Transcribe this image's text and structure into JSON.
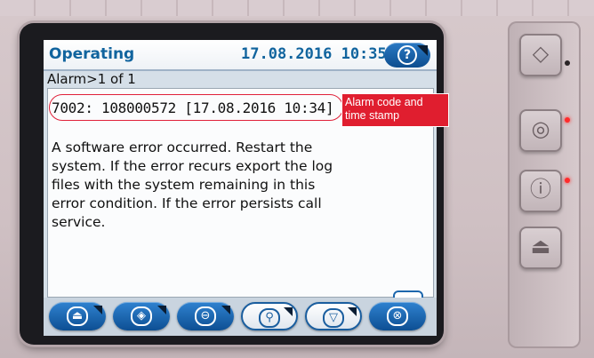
{
  "header": {
    "title": "Operating",
    "datetime": "17.08.2016 10:35",
    "help_icon": "question-circle-icon"
  },
  "alarm": {
    "header": "Alarm>1 of 1",
    "code": "7002: 108000572 [17.08.2016 10:34]",
    "message_lines": [
      "A software error occurred. Restart the",
      "system. If the error recurs export the log",
      "files with the system remaining in this",
      "error condition. If the error persists call",
      "service."
    ]
  },
  "callout": {
    "text": "Alarm code and time stamp"
  },
  "scroll": {
    "icon": "double-chevron-down-icon"
  },
  "toolbar": {
    "buttons": [
      {
        "name": "export-button",
        "icon": "export-tray-icon",
        "glyph": "⏏"
      },
      {
        "name": "navigate-button",
        "icon": "diamond-arrow-icon",
        "glyph": "◈"
      },
      {
        "name": "minus-button",
        "icon": "minus-circle-icon",
        "glyph": "⊖"
      },
      {
        "name": "search-button",
        "icon": "magnifier-icon",
        "glyph": "⚲"
      },
      {
        "name": "filter-button",
        "icon": "funnel-icon",
        "glyph": "▽"
      },
      {
        "name": "cancel-button",
        "icon": "x-circle-icon",
        "glyph": "⊗"
      }
    ]
  },
  "side_panel": {
    "buttons": [
      {
        "icon": "start-diamond-icon",
        "glyph": "◇"
      },
      {
        "icon": "stop-circle-icon",
        "glyph": "◎"
      },
      {
        "icon": "alert-circle-icon",
        "glyph": "ⓘ"
      },
      {
        "icon": "eject-tray-icon",
        "glyph": "⏏"
      }
    ]
  },
  "colors": {
    "title_blue": "#11649e",
    "button_blue": "#1d67ad",
    "callout_red": "#e01e2f",
    "led_red": "#ff2b2b",
    "led_off": "#2a2426"
  }
}
